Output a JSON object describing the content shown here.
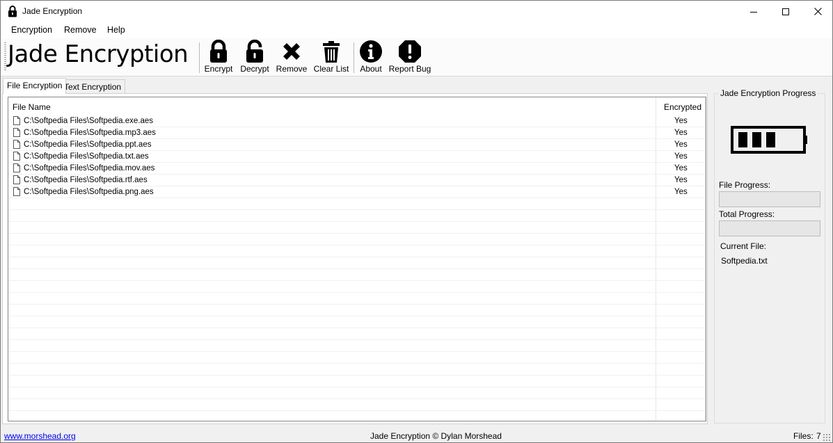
{
  "window": {
    "title": "Jade Encryption",
    "controls": {
      "minimize": "minimize-icon",
      "maximize": "maximize-icon",
      "close": "close-icon"
    }
  },
  "menu": {
    "items": [
      {
        "label": "Encryption"
      },
      {
        "label": "Remove"
      },
      {
        "label": "Help"
      }
    ]
  },
  "toolbar": {
    "brand": "Jade Encryption",
    "buttons": [
      {
        "label": "Encrypt",
        "icon": "lock-icon"
      },
      {
        "label": "Decrypt",
        "icon": "unlock-icon"
      },
      {
        "label": "Remove",
        "icon": "remove-x-icon"
      },
      {
        "label": "Clear List",
        "icon": "trash-icon"
      },
      {
        "label": "About",
        "icon": "info-icon"
      },
      {
        "label": "Report Bug",
        "icon": "bug-alert-icon"
      }
    ]
  },
  "tabs": [
    {
      "label": "File Encryption",
      "active": true
    },
    {
      "label": "Text Encryption",
      "active": false
    }
  ],
  "file_list": {
    "columns": {
      "name": "File Name",
      "encrypted": "Encrypted"
    },
    "rows": [
      {
        "name": "C:\\Softpedia Files\\Softpedia.exe.aes",
        "encrypted": "Yes"
      },
      {
        "name": "C:\\Softpedia Files\\Softpedia.mp3.aes",
        "encrypted": "Yes"
      },
      {
        "name": "C:\\Softpedia Files\\Softpedia.ppt.aes",
        "encrypted": "Yes"
      },
      {
        "name": "C:\\Softpedia Files\\Softpedia.txt.aes",
        "encrypted": "Yes"
      },
      {
        "name": "C:\\Softpedia Files\\Softpedia.mov.aes",
        "encrypted": "Yes"
      },
      {
        "name": "C:\\Softpedia Files\\Softpedia.rtf.aes",
        "encrypted": "Yes"
      },
      {
        "name": "C:\\Softpedia Files\\Softpedia.png.aes",
        "encrypted": "Yes"
      }
    ]
  },
  "progress_panel": {
    "title": "Jade Encryption Progress",
    "icon": "battery-icon",
    "file_progress_label": "File Progress:",
    "file_progress_value": 0,
    "total_progress_label": "Total Progress:",
    "total_progress_value": 0,
    "current_file_label": "Current File:",
    "current_file": "Softpedia.txt"
  },
  "statusbar": {
    "link": "www.morshead.org",
    "center": "Jade Encryption © Dylan Morshead",
    "files_label": "Files:",
    "files_count": "7"
  },
  "colors": {
    "accent_progress": "#06b025",
    "link": "#0000ee"
  }
}
